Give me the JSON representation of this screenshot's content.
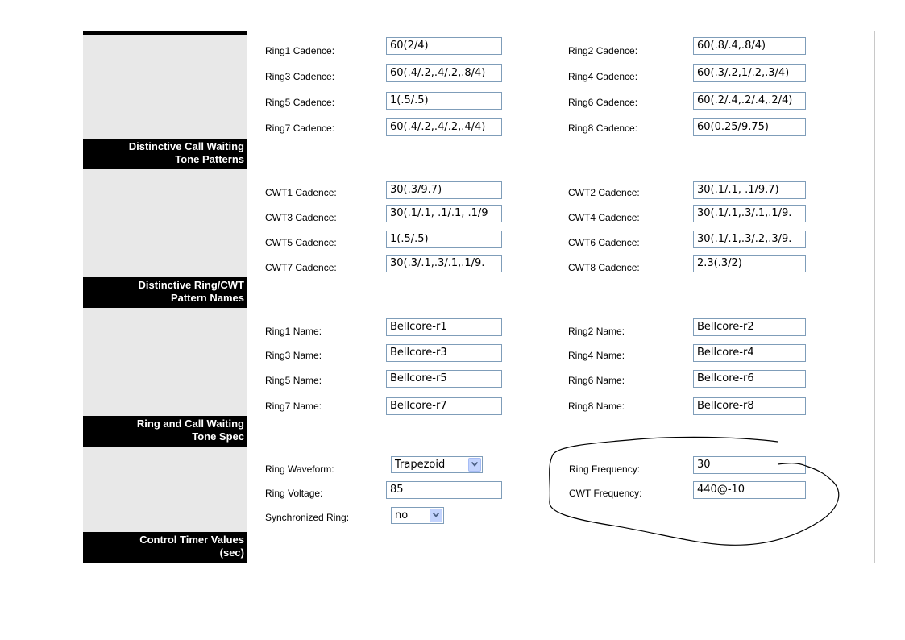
{
  "sections": {
    "distinctive_cwt": {
      "line1": "Distinctive Call Waiting",
      "line2": "Tone Patterns"
    },
    "ring_cwt_names": {
      "line1": "Distinctive Ring/CWT",
      "line2": "Pattern Names"
    },
    "ring_cwt_spec": {
      "line1": "Ring and Call Waiting",
      "line2": "Tone Spec"
    },
    "control_timer": {
      "line1": "Control Timer Values",
      "line2": "(sec)"
    }
  },
  "ring_cadence": [
    {
      "label": "Ring1 Cadence:",
      "value": "60(2/4)"
    },
    {
      "label": "Ring2 Cadence:",
      "value": "60(.8/.4,.8/4)"
    },
    {
      "label": "Ring3 Cadence:",
      "value": "60(.4/.2,.4/.2,.8/4)"
    },
    {
      "label": "Ring4 Cadence:",
      "value": "60(.3/.2,1/.2,.3/4)"
    },
    {
      "label": "Ring5 Cadence:",
      "value": "1(.5/.5)"
    },
    {
      "label": "Ring6 Cadence:",
      "value": "60(.2/.4,.2/.4,.2/4)"
    },
    {
      "label": "Ring7 Cadence:",
      "value": "60(.4/.2,.4/.2,.4/4)"
    },
    {
      "label": "Ring8 Cadence:",
      "value": "60(0.25/9.75)"
    }
  ],
  "cwt_cadence": [
    {
      "label": "CWT1 Cadence:",
      "value": "30(.3/9.7)"
    },
    {
      "label": "CWT2 Cadence:",
      "value": "30(.1/.1, .1/9.7)"
    },
    {
      "label": "CWT3 Cadence:",
      "value": "30(.1/.1, .1/.1, .1/9"
    },
    {
      "label": "CWT4 Cadence:",
      "value": "30(.1/.1,.3/.1,.1/9."
    },
    {
      "label": "CWT5 Cadence:",
      "value": "1(.5/.5)"
    },
    {
      "label": "CWT6 Cadence:",
      "value": "30(.1/.1,.3/.2,.3/9."
    },
    {
      "label": "CWT7 Cadence:",
      "value": "30(.3/.1,.3/.1,.1/9."
    },
    {
      "label": "CWT8 Cadence:",
      "value": "2.3(.3/2)"
    }
  ],
  "ring_names": [
    {
      "label": "Ring1 Name:",
      "value": "Bellcore-r1"
    },
    {
      "label": "Ring2 Name:",
      "value": "Bellcore-r2"
    },
    {
      "label": "Ring3 Name:",
      "value": "Bellcore-r3"
    },
    {
      "label": "Ring4 Name:",
      "value": "Bellcore-r4"
    },
    {
      "label": "Ring5 Name:",
      "value": "Bellcore-r5"
    },
    {
      "label": "Ring6 Name:",
      "value": "Bellcore-r6"
    },
    {
      "label": "Ring7 Name:",
      "value": "Bellcore-r7"
    },
    {
      "label": "Ring8 Name:",
      "value": "Bellcore-r8"
    }
  ],
  "spec": {
    "ring_waveform": {
      "label": "Ring Waveform:",
      "value": "Trapezoid"
    },
    "ring_frequency": {
      "label": "Ring Frequency:",
      "value": "30"
    },
    "ring_voltage": {
      "label": "Ring Voltage:",
      "value": "85"
    },
    "cwt_frequency": {
      "label": "CWT Frequency:",
      "value": "440@-10"
    },
    "synchronized_ring": {
      "label": "Synchronized Ring:",
      "value": "no"
    }
  },
  "colors": {
    "field_border": "#7f9db9",
    "header_bg": "#000000",
    "side_bg": "#e8e8e8",
    "select_arrow": "#c3d3fd"
  }
}
